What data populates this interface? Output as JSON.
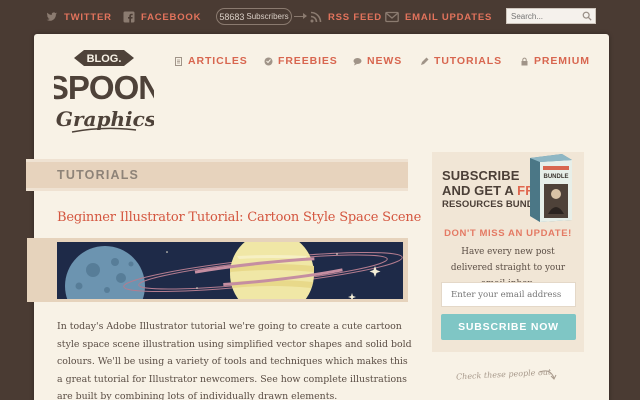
{
  "topbar": {
    "twitter": "TWITTER",
    "facebook": "FACEBOOK",
    "subscribers_count": "58683",
    "subscribers_label": "Subscribers",
    "rss": "RSS FEED",
    "email_updates": "EMAIL UPDATES",
    "search_placeholder": "Search..."
  },
  "logo": {
    "top": "BLOG.",
    "main": "SPOON",
    "script": "Graphics"
  },
  "nav": {
    "articles": "ARTICLES",
    "freebies": "FREEBIES",
    "news": "NEWS",
    "tutorials": "TUTORIALS",
    "premium": "PREMIUM"
  },
  "section": {
    "title": "TUTORIALS"
  },
  "article": {
    "title": "Beginner Illustrator Tutorial: Cartoon Style Space Scene",
    "excerpt": "In today's Adobe Illustrator tutorial we're going to create a cute cartoon style space scene illustration using simplified vector shapes and solid bold colours. We'll be using a variety of tools and techniques which makes this a great tutorial for Illustrator newcomers. See how complete illustrations are built by combining lots of individually drawn elements."
  },
  "sidebar": {
    "promo_line1": "SUBSCRIBE",
    "promo_line2a": "AND GET A ",
    "promo_line2b": "FREE!",
    "promo_line3": "RESOURCES BUNDLE",
    "bundle_label": "BUNDLE",
    "dont_miss": "DON'T MISS AN UPDATE!",
    "description": "Have every new post delivered straight to your email inbox.",
    "email_placeholder": "Enter your email address",
    "subscribe_button": "SUBSCRIBE NOW",
    "check_people": "Check these people out"
  },
  "colors": {
    "topbar_bg": "#4a3b33",
    "accent": "#d8664f",
    "paper": "#f8f2e6",
    "banner": "#e7d3bd",
    "button": "#7fc6c5",
    "space": "#1e2a48"
  },
  "icons": {
    "twitter": "twitter-bird-icon",
    "facebook": "facebook-icon",
    "rss": "rss-icon",
    "email": "envelope-icon",
    "search": "search-icon"
  }
}
